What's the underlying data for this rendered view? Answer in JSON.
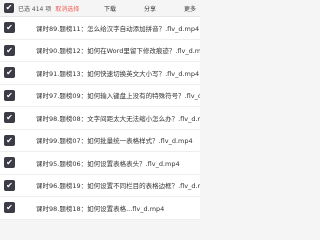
{
  "topbar": {
    "check_glyph": "✔",
    "selected_text": "已选 414 项",
    "cancel_text": "取消选择",
    "download_label": "下载",
    "share_label": "分享",
    "more_label": "更多"
  },
  "rows": [
    {
      "label": "课时89.题榜11：怎么给汉字自动添加拼音？.flv_d.mp4"
    },
    {
      "label": "课时90.题榜12：如何在Word里留下修改痕迹？.flv_d.mp4"
    },
    {
      "label": "课时91.题榜13：如何快速切换英文大小写？.flv_d.mp4"
    },
    {
      "label": "课时97.题榜09：如何输入键盘上没有的特殊符号？.flv_d.mp4"
    },
    {
      "label": "课时98.题榜08：文字间距太大无法缩小怎么办？.flv_d.mp4"
    },
    {
      "label": "课时99.题榜07：如何批量统一表格样式？.flv_d.mp4"
    },
    {
      "label": "课时95.题榜06：如何设置表格表头？.flv_d.mp4"
    },
    {
      "label": "课时96.题榜19：如何设置不同栏目的表格边框？.flv_d.mp4"
    },
    {
      "label": "课时98.题榜18：如何设置表格...flv_d.mp4"
    }
  ],
  "colors": {
    "accent": "#f25c54",
    "checkbox": "#3c3c46"
  }
}
